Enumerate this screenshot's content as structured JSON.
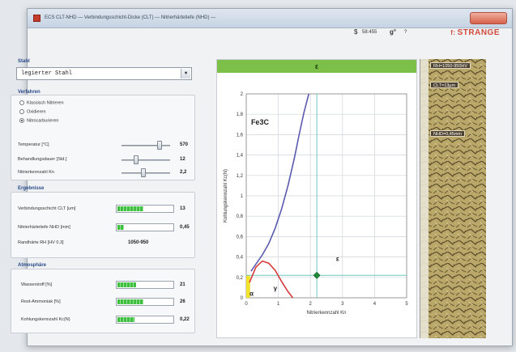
{
  "window": {
    "title": "ECS CLT-NHD  —  Verbindungsschicht-Dicke (CLT)  —  Nitrierhärtetiefe (NHD)  —",
    "toolbar": {
      "value": "58:455",
      "g_icon": "g°",
      "help": "?",
      "brand": "STRANGE"
    }
  },
  "stahl": {
    "label": "Stahl",
    "selected": "legierter Stahl"
  },
  "verfahren": {
    "label": "Verfahren",
    "options": [
      {
        "label": "Klassisch Nitrieren",
        "checked": false
      },
      {
        "label": "Oxidieren",
        "checked": false
      },
      {
        "label": "Nitrocarburieren",
        "checked": true
      }
    ],
    "rows": [
      {
        "label": "Temperatur [°C]",
        "value": "570",
        "level": 0.78
      },
      {
        "label": "Behandlungsdauer [Std.]",
        "value": "12",
        "level": 0.3
      },
      {
        "label": "Nitrierkennzahl Kn",
        "value": "2,2",
        "level": 0.45
      }
    ]
  },
  "ergebnisse": {
    "label": "Ergebnisse",
    "rows": [
      {
        "label": "Verbindungsschicht CLT [um]",
        "value": "13",
        "fill": 0.45
      },
      {
        "label": "Nitrierhärtetiefe NHD [mm]",
        "value": "0,45",
        "fill": 0.12
      },
      {
        "label": "Randhärte RH [HV 0.3]",
        "value": "1050-950"
      }
    ]
  },
  "atmosphaere": {
    "label": "Atmosphäre",
    "rows": [
      {
        "label": "Wasserstoff [%]",
        "value": "21",
        "fill": 0.33
      },
      {
        "label": "Rest-Ammoniak [%]",
        "value": "26",
        "fill": 0.45
      },
      {
        "label": "Kohlungskennzahl Kc(N)",
        "value": "0,22",
        "fill": 0.3
      }
    ]
  },
  "chart_data": {
    "type": "line",
    "header": "ε",
    "xlabel": "Nitrierkennzahl Kn",
    "ylabel": "Kohlungskennzahl Kc(N)",
    "xlim": [
      0,
      5
    ],
    "ylim": [
      0,
      2
    ],
    "xticks": [
      "0",
      "1",
      "2",
      "3",
      "4",
      "5"
    ],
    "yticks": [
      "0",
      "0,2",
      "0,4",
      "0,6",
      "0,8",
      "1",
      "1,2",
      "1,4",
      "1,6",
      "1,8",
      "2"
    ],
    "series": [
      {
        "color": "#5a5ab0",
        "x": [
          0.15,
          0.3,
          0.5,
          0.7,
          0.9,
          1.1,
          1.3,
          1.5,
          1.65,
          1.8,
          1.95
        ],
        "y": [
          0.26,
          0.33,
          0.42,
          0.53,
          0.68,
          0.87,
          1.1,
          1.37,
          1.6,
          1.82,
          2.0
        ]
      },
      {
        "color": "#d63a3a",
        "x": [
          0.1,
          0.3,
          0.5,
          0.7,
          0.9,
          1.1,
          1.3,
          1.45
        ],
        "y": [
          0.15,
          0.3,
          0.36,
          0.34,
          0.27,
          0.16,
          0.06,
          0.0
        ]
      }
    ],
    "operating_point": {
      "x": 2.2,
      "y": 0.22
    },
    "vline_x": 2.2,
    "region_labels": [
      {
        "text": "Fe3C",
        "x": 0.15,
        "y": 1.7
      },
      {
        "text": "ε",
        "x": 2.8,
        "y": 0.36
      },
      {
        "text": "γ",
        "x": 0.85,
        "y": 0.07
      },
      {
        "text": "α",
        "x": 0.1,
        "y": 0.02
      }
    ],
    "grid": true
  },
  "micrograph": {
    "tags": [
      "RH=1050-950HV",
      "CLT=13µm",
      "NHD=0,45mm"
    ]
  },
  "colors": {
    "accent": "#7cc04a",
    "section": "#2a4a8a",
    "brand": "#d14b3c"
  }
}
